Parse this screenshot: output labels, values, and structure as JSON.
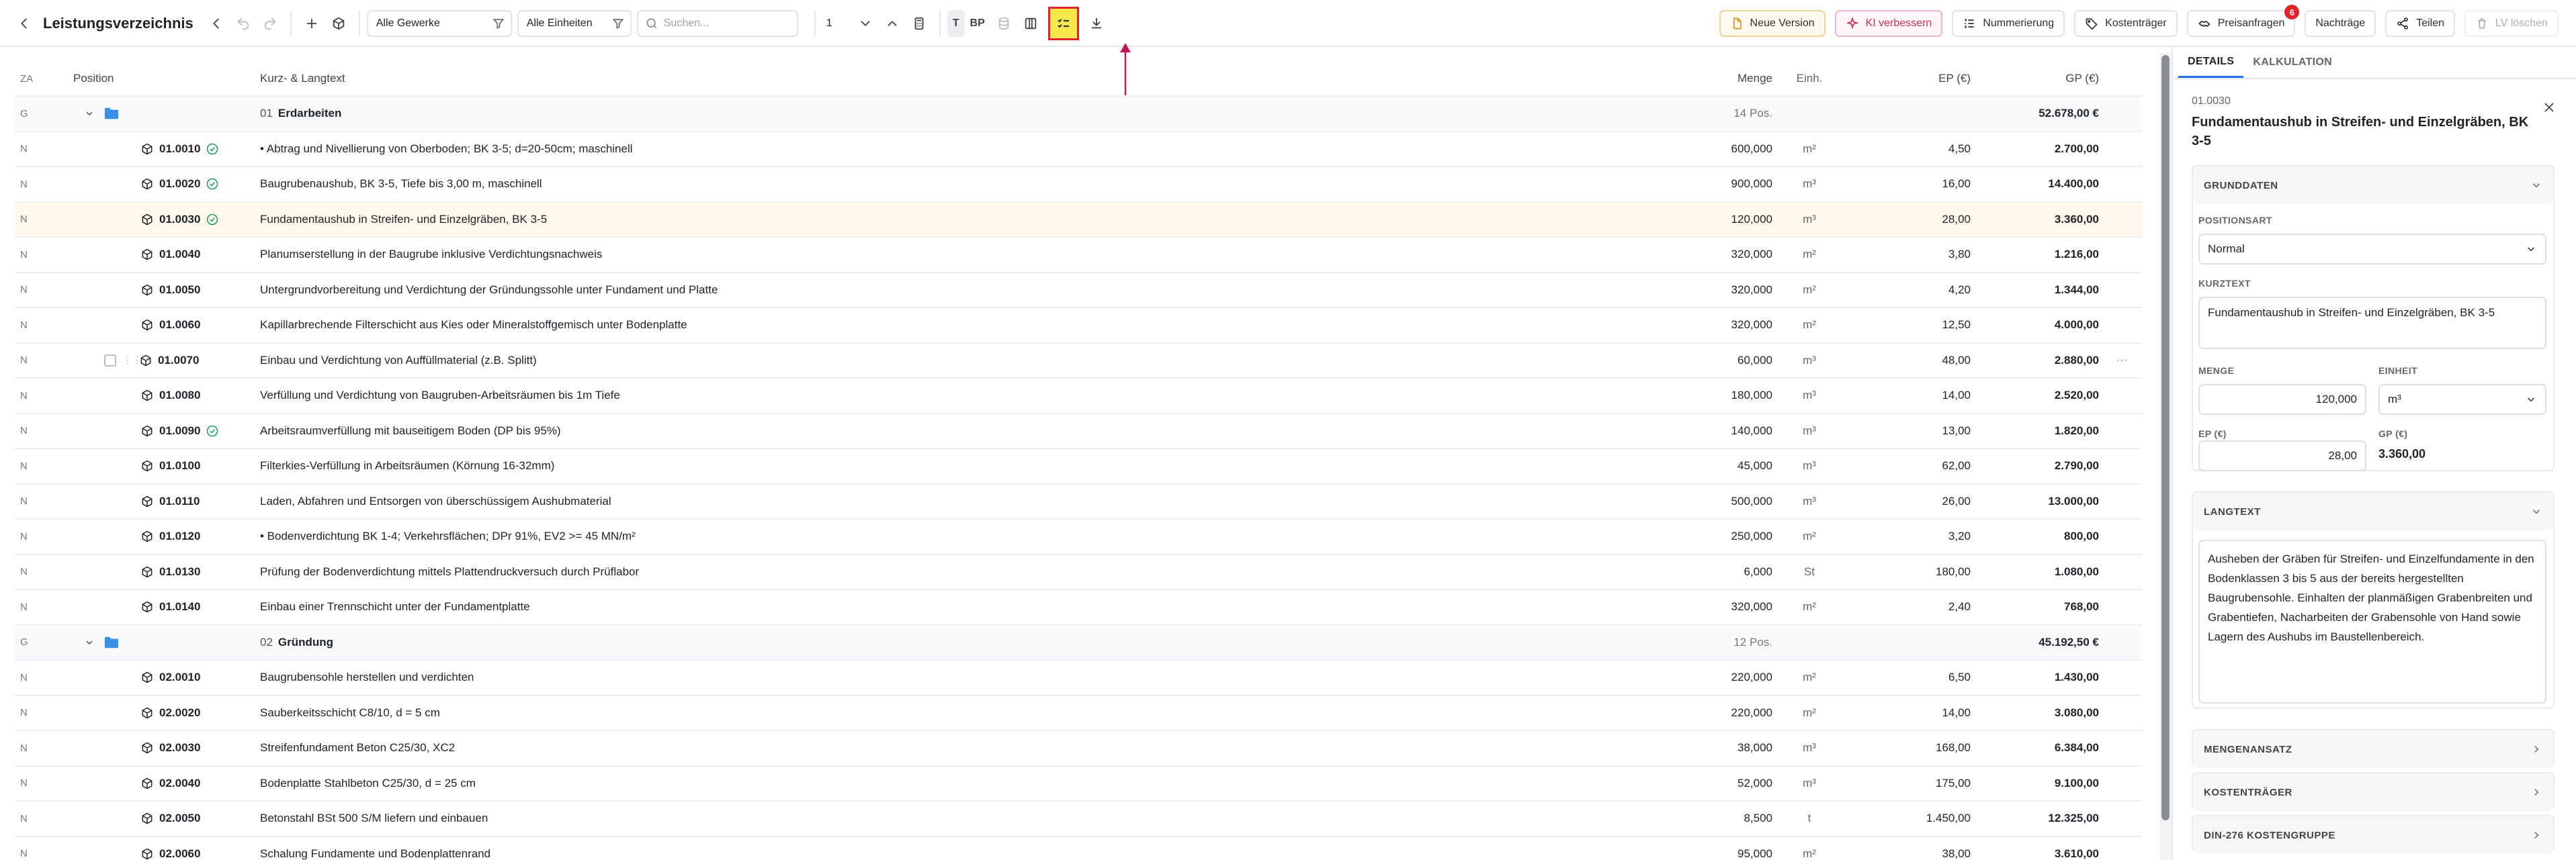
{
  "toolbar": {
    "title": "Leistungsverzeichnis",
    "filter_gewerke": "Alle Gewerke",
    "filter_einheiten": "Alle Einheiten",
    "search_placeholder": "Suchen...",
    "page": "1",
    "toggle_t": "T",
    "toggle_bp": "BP",
    "btn_new_version": "Neue Version",
    "btn_ki": "KI verbessern",
    "btn_numbering": "Nummerierung",
    "btn_kostentraeger": "Kostenträger",
    "btn_preisanfragen": "Preisanfragen",
    "preisanfragen_badge": "6",
    "btn_nachtraege": "Nachträge",
    "btn_teilen": "Teilen",
    "btn_lv_loeschen": "LV löschen"
  },
  "table": {
    "headers": {
      "za": "ZA",
      "position": "Position",
      "text": "Kurz- & Langtext",
      "menge": "Menge",
      "einh": "Einh.",
      "ep": "EP (€)",
      "gp": "GP (€)"
    },
    "rows": [
      {
        "type": "group",
        "za": "G",
        "num": "01",
        "name": "Erdarbeiten",
        "count": "14 Pos.",
        "gp": "52.678,00 €"
      },
      {
        "type": "item",
        "za": "N",
        "pos": "01.0010",
        "ok": true,
        "text": "• Abtrag und Nivellierung von Oberboden; BK 3-5; d=20-50cm; maschinell",
        "menge": "600,000",
        "einh": "m²",
        "ep": "4,50",
        "gp": "2.700,00"
      },
      {
        "type": "item",
        "za": "N",
        "pos": "01.0020",
        "ok": true,
        "text": "Baugrubenaushub, BK 3-5, Tiefe bis 3,00 m, maschinell",
        "menge": "900,000",
        "einh": "m³",
        "ep": "16,00",
        "gp": "14.400,00"
      },
      {
        "type": "item",
        "za": "N",
        "pos": "01.0030",
        "ok": true,
        "selected": true,
        "text": "Fundamentaushub in Streifen- und Einzelgräben, BK 3-5",
        "menge": "120,000",
        "einh": "m³",
        "ep": "28,00",
        "gp": "3.360,00"
      },
      {
        "type": "item",
        "za": "N",
        "pos": "01.0040",
        "text": "Planumserstellung in der Baugrube inklusive Verdichtungsnachweis",
        "menge": "320,000",
        "einh": "m²",
        "ep": "3,80",
        "gp": "1.216,00"
      },
      {
        "type": "item",
        "za": "N",
        "pos": "01.0050",
        "text": "Untergrundvorbereitung und Verdichtung der Gründungssohle unter Fundament und Platte",
        "menge": "320,000",
        "einh": "m²",
        "ep": "4,20",
        "gp": "1.344,00"
      },
      {
        "type": "item",
        "za": "N",
        "pos": "01.0060",
        "text": "Kapillarbrechende Filterschicht aus Kies oder Mineralstoffgemisch unter Bodenplatte",
        "menge": "320,000",
        "einh": "m²",
        "ep": "12,50",
        "gp": "4.000,00"
      },
      {
        "type": "item",
        "za": "N",
        "pos": "01.0070",
        "hover": true,
        "text": "Einbau und Verdichtung von Auffüllmaterial (z.B. Splitt)",
        "menge": "60,000",
        "einh": "m³",
        "ep": "48,00",
        "gp": "2.880,00"
      },
      {
        "type": "item",
        "za": "N",
        "pos": "01.0080",
        "text": "Verfüllung und Verdichtung von Baugruben-Arbeitsräumen bis 1m Tiefe",
        "menge": "180,000",
        "einh": "m³",
        "ep": "14,00",
        "gp": "2.520,00"
      },
      {
        "type": "item",
        "za": "N",
        "pos": "01.0090",
        "ok": true,
        "text": "Arbeitsraumverfüllung mit bauseitigem Boden (DP bis 95%)",
        "menge": "140,000",
        "einh": "m³",
        "ep": "13,00",
        "gp": "1.820,00"
      },
      {
        "type": "item",
        "za": "N",
        "pos": "01.0100",
        "text": "Filterkies-Verfüllung in Arbeitsräumen (Körnung 16-32mm)",
        "menge": "45,000",
        "einh": "m³",
        "ep": "62,00",
        "gp": "2.790,00"
      },
      {
        "type": "item",
        "za": "N",
        "pos": "01.0110",
        "text": "Laden, Abfahren und Entsorgen von überschüssigem Aushubmaterial",
        "menge": "500,000",
        "einh": "m³",
        "ep": "26,00",
        "gp": "13.000,00"
      },
      {
        "type": "item",
        "za": "N",
        "pos": "01.0120",
        "text": "• Bodenverdichtung BK 1-4; Verkehrsflächen; DPr 91%, EV2 >= 45 MN/m²",
        "menge": "250,000",
        "einh": "m²",
        "ep": "3,20",
        "gp": "800,00"
      },
      {
        "type": "item",
        "za": "N",
        "pos": "01.0130",
        "text": "Prüfung der Bodenverdichtung mittels Plattendruckversuch durch Prüflabor",
        "menge": "6,000",
        "einh": "St",
        "ep": "180,00",
        "gp": "1.080,00"
      },
      {
        "type": "item",
        "za": "N",
        "pos": "01.0140",
        "text": "Einbau einer Trennschicht unter der Fundamentplatte",
        "menge": "320,000",
        "einh": "m²",
        "ep": "2,40",
        "gp": "768,00"
      },
      {
        "type": "group",
        "za": "G",
        "num": "02",
        "name": "Gründung",
        "count": "12 Pos.",
        "gp": "45.192,50 €"
      },
      {
        "type": "item",
        "za": "N",
        "pos": "02.0010",
        "text": "Baugrubensohle herstellen und verdichten",
        "menge": "220,000",
        "einh": "m²",
        "ep": "6,50",
        "gp": "1.430,00"
      },
      {
        "type": "item",
        "za": "N",
        "pos": "02.0020",
        "text": "Sauberkeitsschicht C8/10, d = 5 cm",
        "menge": "220,000",
        "einh": "m²",
        "ep": "14,00",
        "gp": "3.080,00"
      },
      {
        "type": "item",
        "za": "N",
        "pos": "02.0030",
        "text": "Streifenfundament Beton C25/30, XC2",
        "menge": "38,000",
        "einh": "m³",
        "ep": "168,00",
        "gp": "6.384,00"
      },
      {
        "type": "item",
        "za": "N",
        "pos": "02.0040",
        "text": "Bodenplatte Stahlbeton C25/30, d = 25 cm",
        "menge": "52,000",
        "einh": "m³",
        "ep": "175,00",
        "gp": "9.100,00"
      },
      {
        "type": "item",
        "za": "N",
        "pos": "02.0050",
        "text": "Betonstahl BSt 500 S/M liefern und einbauen",
        "menge": "8,500",
        "einh": "t",
        "ep": "1.450,00",
        "gp": "12.325,00"
      },
      {
        "type": "item",
        "za": "N",
        "pos": "02.0060",
        "text": "Schalung Fundamente und Bodenplattenrand",
        "menge": "95,000",
        "einh": "m²",
        "ep": "38,00",
        "gp": "3.610,00"
      }
    ]
  },
  "panel": {
    "tab_details": "DETAILS",
    "tab_kalkulation": "KALKULATION",
    "pos_id": "01.0030",
    "title": "Fundamentaushub in Streifen- und Einzelgräben, BK 3-5",
    "grunddaten": "GRUNDDATEN",
    "positionsart_label": "POSITIONSART",
    "positionsart_value": "Normal",
    "kurztext_label": "KURZTEXT",
    "kurztext_value": "Fundamentaushub in Streifen- und Einzelgräben, BK 3-5",
    "menge_label": "MENGE",
    "menge_value": "120,000",
    "einheit_label": "EINHEIT",
    "einheit_value": "m³",
    "ep_label": "EP (€)",
    "ep_value": "28,00",
    "gp_label": "GP (€)",
    "gp_value": "3.360,00",
    "langtext": "LANGTEXT",
    "langtext_value": "Ausheben der Gräben für Streifen- und Einzelfundamente in den Bodenklassen 3 bis 5 aus der bereits hergestellten Baugrubensohle. Einhalten der planmäßigen Grabenbreiten und Grabentiefen, Nacharbeiten der Grabensohle von Hand sowie Lagern des Aushubs im Baustellenbereich.",
    "mengenansatz": "MENGENANSATZ",
    "kostentraeger": "KOSTENTRÄGER",
    "din276": "DIN-276 KOSTENGRUPPE"
  },
  "colors": {
    "accent": "#1f6feb",
    "highlight": "#f5e84a",
    "annotation": "#c2185b",
    "ki": "#c92f5a"
  }
}
